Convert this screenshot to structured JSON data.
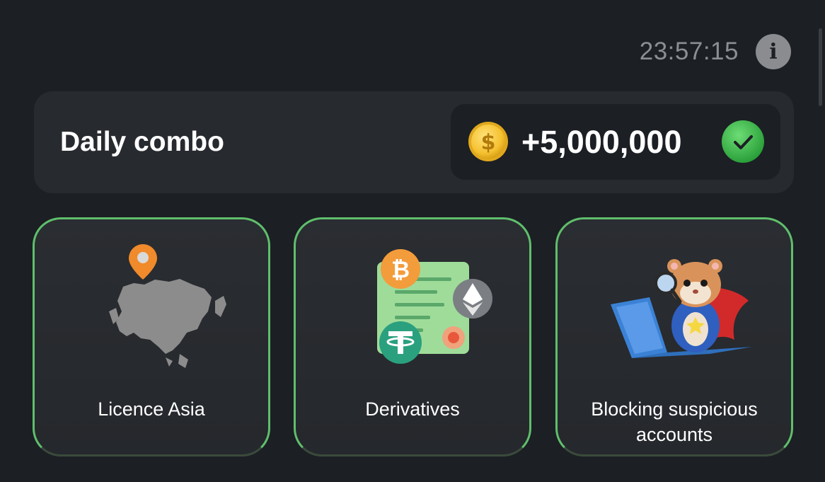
{
  "timer": "23:57:15",
  "info_icon": "info-icon",
  "combo": {
    "title": "Daily combo",
    "reward": "+5,000,000",
    "coin_icon": "coin-icon",
    "status_icon": "check-icon"
  },
  "cards": [
    {
      "label": "Licence Asia",
      "icon": "asia-map-icon"
    },
    {
      "label": "Derivatives",
      "icon": "crypto-document-icon"
    },
    {
      "label": "Blocking suspicious accounts",
      "icon": "hamster-detective-icon"
    }
  ],
  "colors": {
    "background": "#1c1f24",
    "panel": "#272a2f",
    "card_border": "#5fbf6c",
    "check": "#3db34a",
    "coin": "#f5c131"
  }
}
